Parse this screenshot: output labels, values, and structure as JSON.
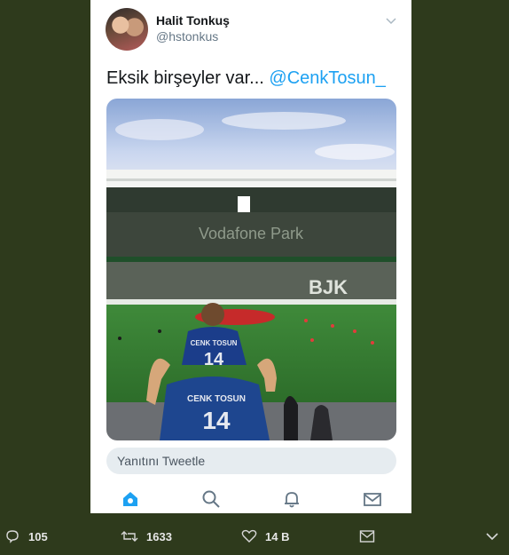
{
  "tweet": {
    "author_name": "Halit Tonkuş",
    "author_handle": "@hstonkus",
    "text_plain": "Eksik birşeyler var... ",
    "mention": "@CenkTosun_",
    "photo": {
      "stadium_sign_upper": "Vodafone Park",
      "stadium_sign_lower": "BJK",
      "jersey_name_child": "CENK TOSUN",
      "jersey_number_child": "14",
      "jersey_name_adult": "CENK TOSUN",
      "jersey_number_adult": "14"
    }
  },
  "reply": {
    "placeholder": "Yanıtını Tweetle"
  },
  "bottom_nav": [
    "home-icon",
    "search-icon",
    "notifications-icon",
    "messages-icon"
  ],
  "footer": {
    "reply_count": "105",
    "retweet_count": "1633",
    "like_count": "14 B"
  },
  "colors": {
    "accent": "#1da1f2",
    "page_background": "#2e3a1c"
  }
}
